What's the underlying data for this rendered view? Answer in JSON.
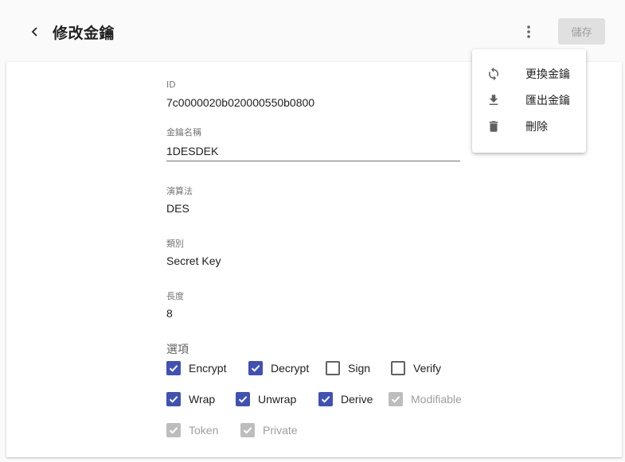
{
  "header": {
    "title": "修改金鑰",
    "save_label": "儲存"
  },
  "form": {
    "id": {
      "label": "ID",
      "value": "7c0000020b020000550b0800"
    },
    "name": {
      "label": "金鑰名稱",
      "value": "1DESDEK"
    },
    "algorithm": {
      "label": "演算法",
      "value": "DES"
    },
    "type": {
      "label": "類別",
      "value": "Secret Key"
    },
    "length": {
      "label": "長度",
      "value": "8"
    }
  },
  "options": {
    "title": "選項",
    "rows": [
      [
        {
          "label": "Encrypt",
          "state": "checked"
        },
        {
          "label": "Decrypt",
          "state": "checked"
        },
        {
          "label": "Sign",
          "state": "unchecked"
        },
        {
          "label": "Verify",
          "state": "unchecked"
        }
      ],
      [
        {
          "label": "Wrap",
          "state": "checked"
        },
        {
          "label": "Unwrap",
          "state": "checked"
        },
        {
          "label": "Derive",
          "state": "checked"
        },
        {
          "label": "Modifiable",
          "state": "disabled"
        }
      ],
      [
        {
          "label": "Token",
          "state": "disabled"
        },
        {
          "label": "Private",
          "state": "disabled"
        }
      ]
    ]
  },
  "menu": {
    "items": [
      {
        "label": "更換金鑰",
        "icon": "refresh-icon"
      },
      {
        "label": "匯出金鑰",
        "icon": "download-icon"
      },
      {
        "label": "刪除",
        "icon": "trash-icon"
      }
    ]
  },
  "colors": {
    "accent": "#3f51b5",
    "disabled": "#bdbdbd"
  }
}
